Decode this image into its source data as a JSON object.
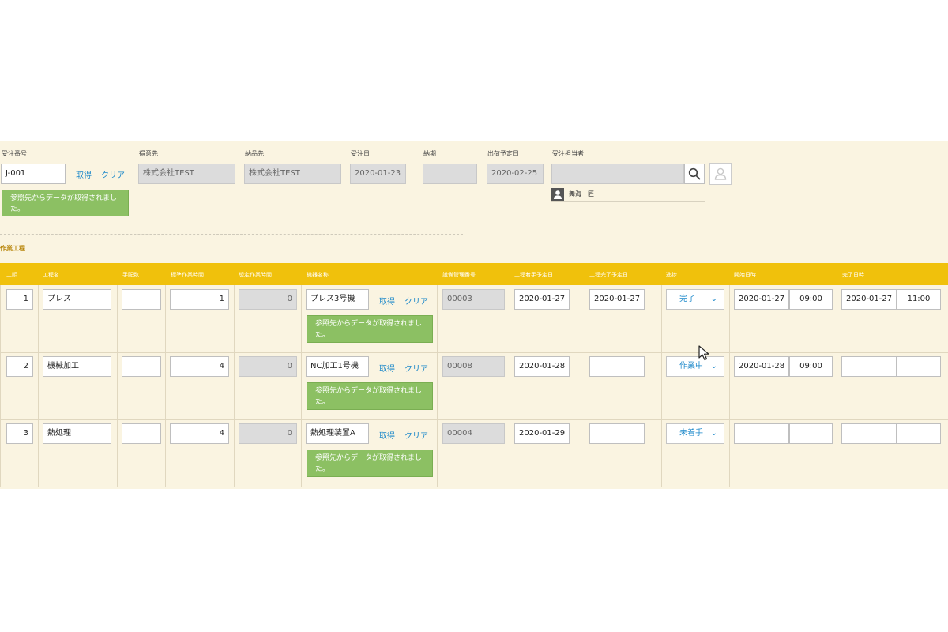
{
  "header": {
    "order_no": {
      "label": "受注番号",
      "value": "J-001"
    },
    "fetch_label": "取得",
    "clear_label": "クリア",
    "customer": {
      "label": "得意先",
      "value": "株式会社TEST"
    },
    "delivery_dest": {
      "label": "納品先",
      "value": "株式会社TEST"
    },
    "order_date": {
      "label": "受注日",
      "value": "2020-01-23"
    },
    "due_date": {
      "label": "納期",
      "value": ""
    },
    "ship_date": {
      "label": "出荷予定日",
      "value": "2020-02-25"
    },
    "rep": {
      "label": "受注担当者",
      "value": "",
      "selected_name": "舞海　匠"
    },
    "message": "参照先からデータが取得されました。"
  },
  "section_title": "作業工程",
  "columns": [
    "工順",
    "工程名",
    "手配数",
    "標準作業時間",
    "想定作業時間",
    "機器名称",
    "設備管理番号",
    "工程着手予定日",
    "工程完了予定日",
    "進捗",
    "開始日時",
    "完了日時"
  ],
  "rows": [
    {
      "seq": "1",
      "process": "プレス",
      "qty": "",
      "std_time": "1",
      "est_time": "0",
      "equipment": "プレス3号機",
      "equip_no": "00003",
      "start_plan": "2020-01-27",
      "end_plan": "2020-01-27",
      "status": "完了",
      "start_date": "2020-01-27",
      "start_time": "09:00",
      "end_date": "2020-01-27",
      "end_time": "11:00"
    },
    {
      "seq": "2",
      "process": "機械加工",
      "qty": "",
      "std_time": "4",
      "est_time": "0",
      "equipment": "NC加工1号機",
      "equip_no": "00008",
      "start_plan": "2020-01-28",
      "end_plan": "",
      "status": "作業中",
      "start_date": "2020-01-28",
      "start_time": "09:00",
      "end_date": "",
      "end_time": ""
    },
    {
      "seq": "3",
      "process": "熱処理",
      "qty": "",
      "std_time": "4",
      "est_time": "0",
      "equipment": "熱処理装置A",
      "equip_no": "00004",
      "start_plan": "2020-01-29",
      "end_plan": "",
      "status": "未着手",
      "start_date": "",
      "start_time": "",
      "end_date": "",
      "end_time": ""
    }
  ],
  "colors": {
    "header": "#f0c10c",
    "background": "#faf4e1",
    "message": "#8cc063",
    "link": "#1a87c9"
  },
  "icons": {
    "search": "search-icon",
    "user": "user-icon",
    "person": "person-icon",
    "chevron": "chevron-down-icon"
  }
}
